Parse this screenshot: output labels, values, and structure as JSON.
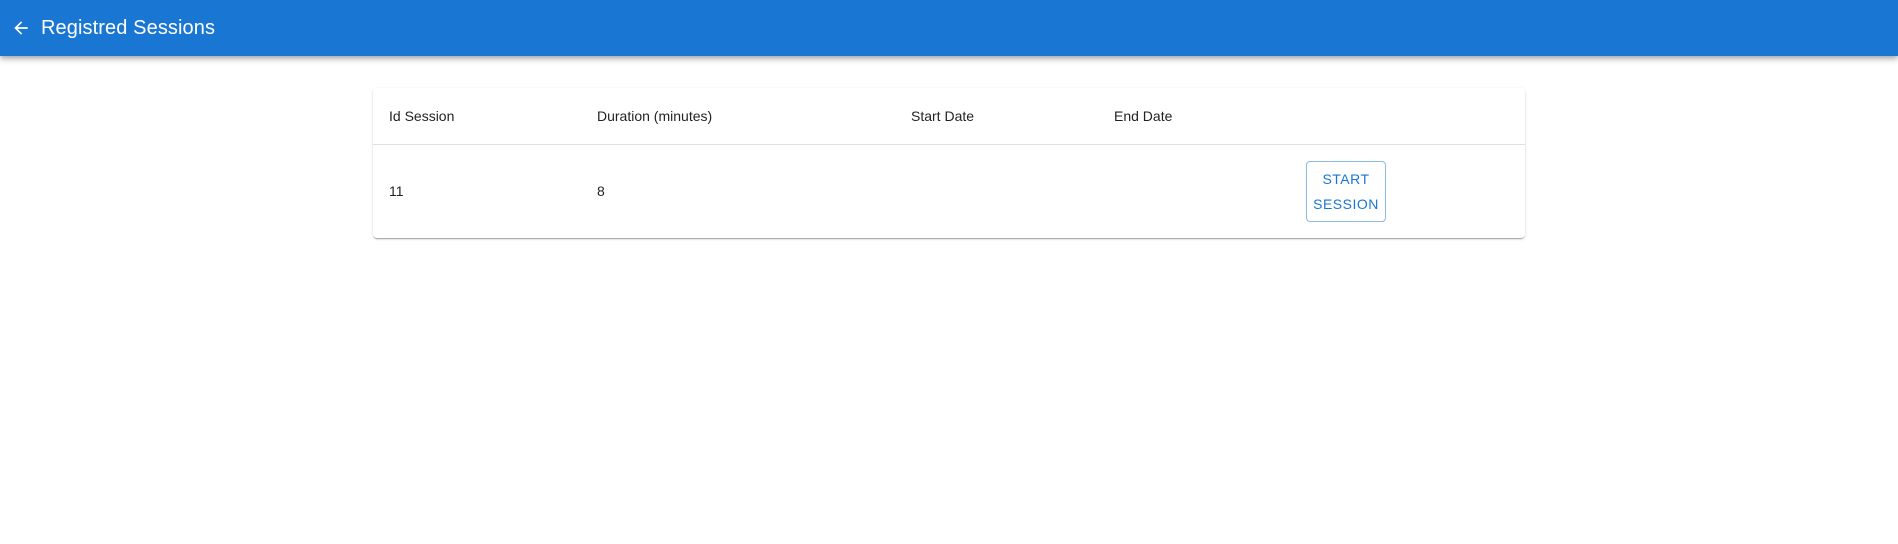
{
  "appbar": {
    "title": "Registred Sessions",
    "back_icon": "arrow-back-icon",
    "color": "#1976d2"
  },
  "table": {
    "headers": [
      "Id Session",
      "Duration (minutes)",
      "Start Date",
      "End Date",
      ""
    ],
    "rows": [
      {
        "id": "11",
        "duration": "8",
        "start_date": "",
        "end_date": "",
        "action_label": "START SESSION"
      }
    ]
  }
}
